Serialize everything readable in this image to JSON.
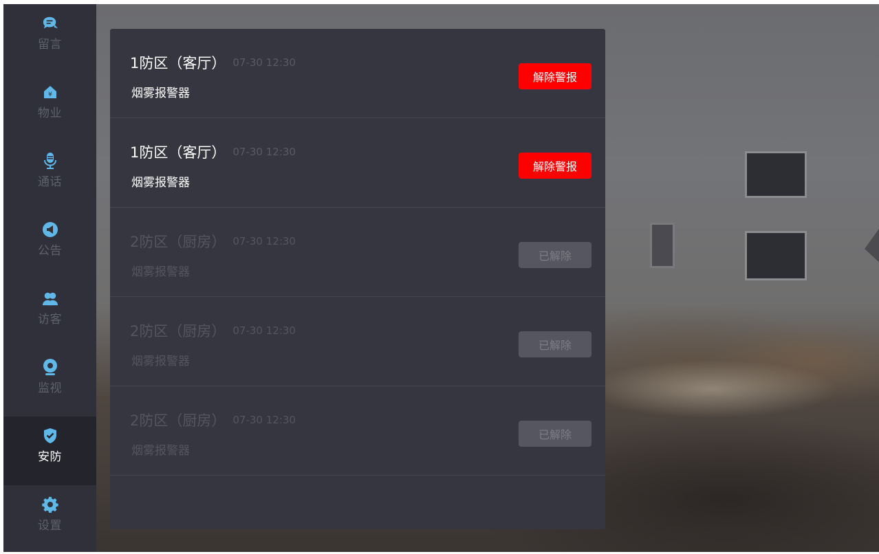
{
  "sidebar": {
    "items": [
      {
        "label": "留言",
        "icon": "message-icon"
      },
      {
        "label": "物业",
        "icon": "property-home-icon"
      },
      {
        "label": "通话",
        "icon": "microphone-icon"
      },
      {
        "label": "公告",
        "icon": "megaphone-icon"
      },
      {
        "label": "访客",
        "icon": "visitors-icon"
      },
      {
        "label": "监视",
        "icon": "camera-icon"
      },
      {
        "label": "安防",
        "icon": "shield-check-icon",
        "active": true
      },
      {
        "label": "设置",
        "icon": "gear-icon"
      }
    ]
  },
  "alarms": [
    {
      "zone": "1防区（客厅）",
      "time": "07-30 12:30",
      "device": "烟雾报警器",
      "button": "解除警报",
      "state": "active"
    },
    {
      "zone": "1防区（客厅）",
      "time": "07-30 12:30",
      "device": "烟雾报警器",
      "button": "解除警报",
      "state": "active"
    },
    {
      "zone": "2防区（厨房）",
      "time": "07-30 12:30",
      "device": "烟雾报警器",
      "button": "已解除",
      "state": "cleared"
    },
    {
      "zone": "2防区（厨房）",
      "time": "07-30 12:30",
      "device": "烟雾报警器",
      "button": "已解除",
      "state": "cleared"
    },
    {
      "zone": "2防区（厨房）",
      "time": "07-30 12:30",
      "device": "烟雾报警器",
      "button": "已解除",
      "state": "cleared"
    }
  ],
  "colors": {
    "accent": "#5fb8e8",
    "alarm": "#ff0000",
    "sidebar": "#2f3039",
    "panel": "#363640"
  }
}
